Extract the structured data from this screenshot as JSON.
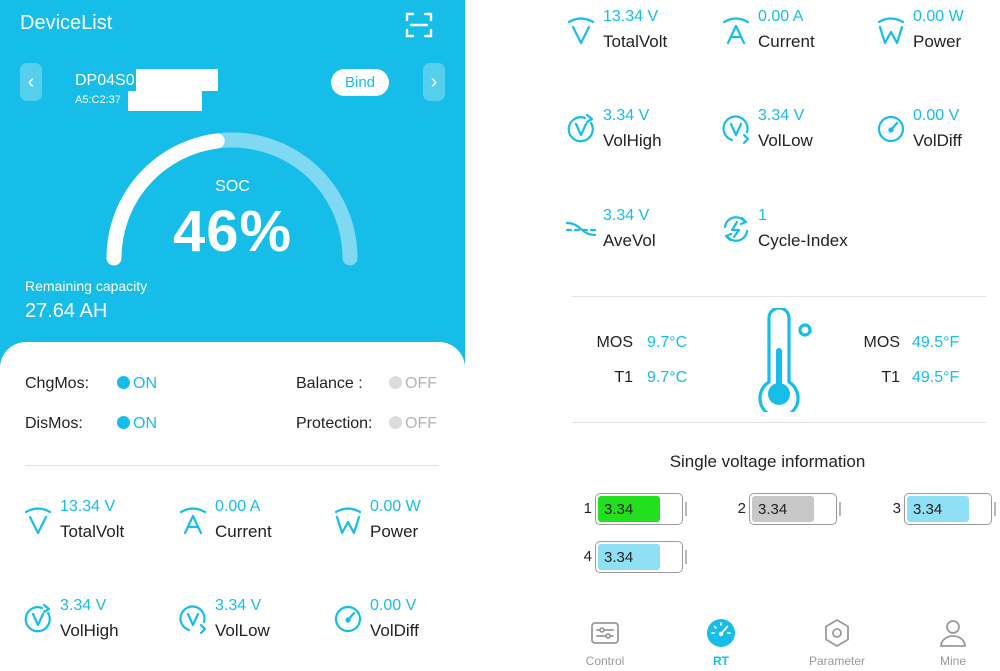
{
  "header": {
    "title": "DeviceList",
    "bind_label": "Bind",
    "prev_icon": "chevron-left-icon",
    "next_icon": "chevron-right-icon",
    "scan_icon": "scan-icon"
  },
  "device": {
    "name": "DP04S0",
    "mac": "A5:C2:37"
  },
  "soc": {
    "label": "SOC",
    "value": "46%",
    "level": 0.46
  },
  "capacity": {
    "label": "Remaining capacity",
    "value": "27.64 AH"
  },
  "status": [
    {
      "label": "ChgMos:",
      "state": "ON"
    },
    {
      "label": "Balance :",
      "state": "OFF"
    },
    {
      "label": "DisMos:",
      "state": "ON"
    },
    {
      "label": "Protection:",
      "state": "OFF"
    }
  ],
  "metrics": {
    "total_volt": {
      "value": "13.34 V",
      "label": "TotalVolt",
      "icon": "total-volt-icon"
    },
    "current": {
      "value": "0.00 A",
      "label": "Current",
      "icon": "current-icon"
    },
    "power": {
      "value": "0.00 W",
      "label": "Power",
      "icon": "power-icon"
    },
    "vol_high": {
      "value": "3.34 V",
      "label": "VolHigh",
      "icon": "vol-high-icon"
    },
    "vol_low": {
      "value": "3.34 V",
      "label": "VolLow",
      "icon": "vol-low-icon"
    },
    "vol_diff": {
      "value": "0.00 V",
      "label": "VolDiff",
      "icon": "vol-diff-icon"
    },
    "ave_vol": {
      "value": "3.34 V",
      "label": "AveVol",
      "icon": "ave-vol-icon"
    },
    "cycle_index": {
      "value": "1",
      "label": "Cycle-Index",
      "icon": "cycle-icon"
    }
  },
  "temperature": {
    "mos_c": {
      "label": "MOS",
      "value": "9.7°C"
    },
    "t1_c": {
      "label": "T1",
      "value": "9.7°C"
    },
    "mos_f": {
      "label": "MOS",
      "value": "49.5°F"
    },
    "t1_f": {
      "label": "T1",
      "value": "49.5°F"
    }
  },
  "single_voltage": {
    "title": "Single voltage information",
    "cells": [
      {
        "index": "1",
        "value": "3.34",
        "color": "#22e01e",
        "fill": 0.75
      },
      {
        "index": "2",
        "value": "3.34",
        "color": "#c8c8c8",
        "fill": 0.75
      },
      {
        "index": "3",
        "value": "3.34",
        "color": "#8fdff5",
        "fill": 0.75
      },
      {
        "index": "4",
        "value": "3.34",
        "color": "#8fdff5",
        "fill": 0.75
      }
    ]
  },
  "bottom_nav": [
    {
      "label": "Control",
      "icon": "sliders-icon",
      "active": false
    },
    {
      "label": "RT",
      "icon": "dashboard-icon",
      "active": true
    },
    {
      "label": "Parameter",
      "icon": "hexagon-settings-icon",
      "active": false
    },
    {
      "label": "Mine",
      "icon": "user-icon",
      "active": false
    }
  ],
  "colors": {
    "accent": "#15bde8",
    "text": "#222222",
    "inactive": "#9a9a9a",
    "off": "#b5b5b5"
  }
}
